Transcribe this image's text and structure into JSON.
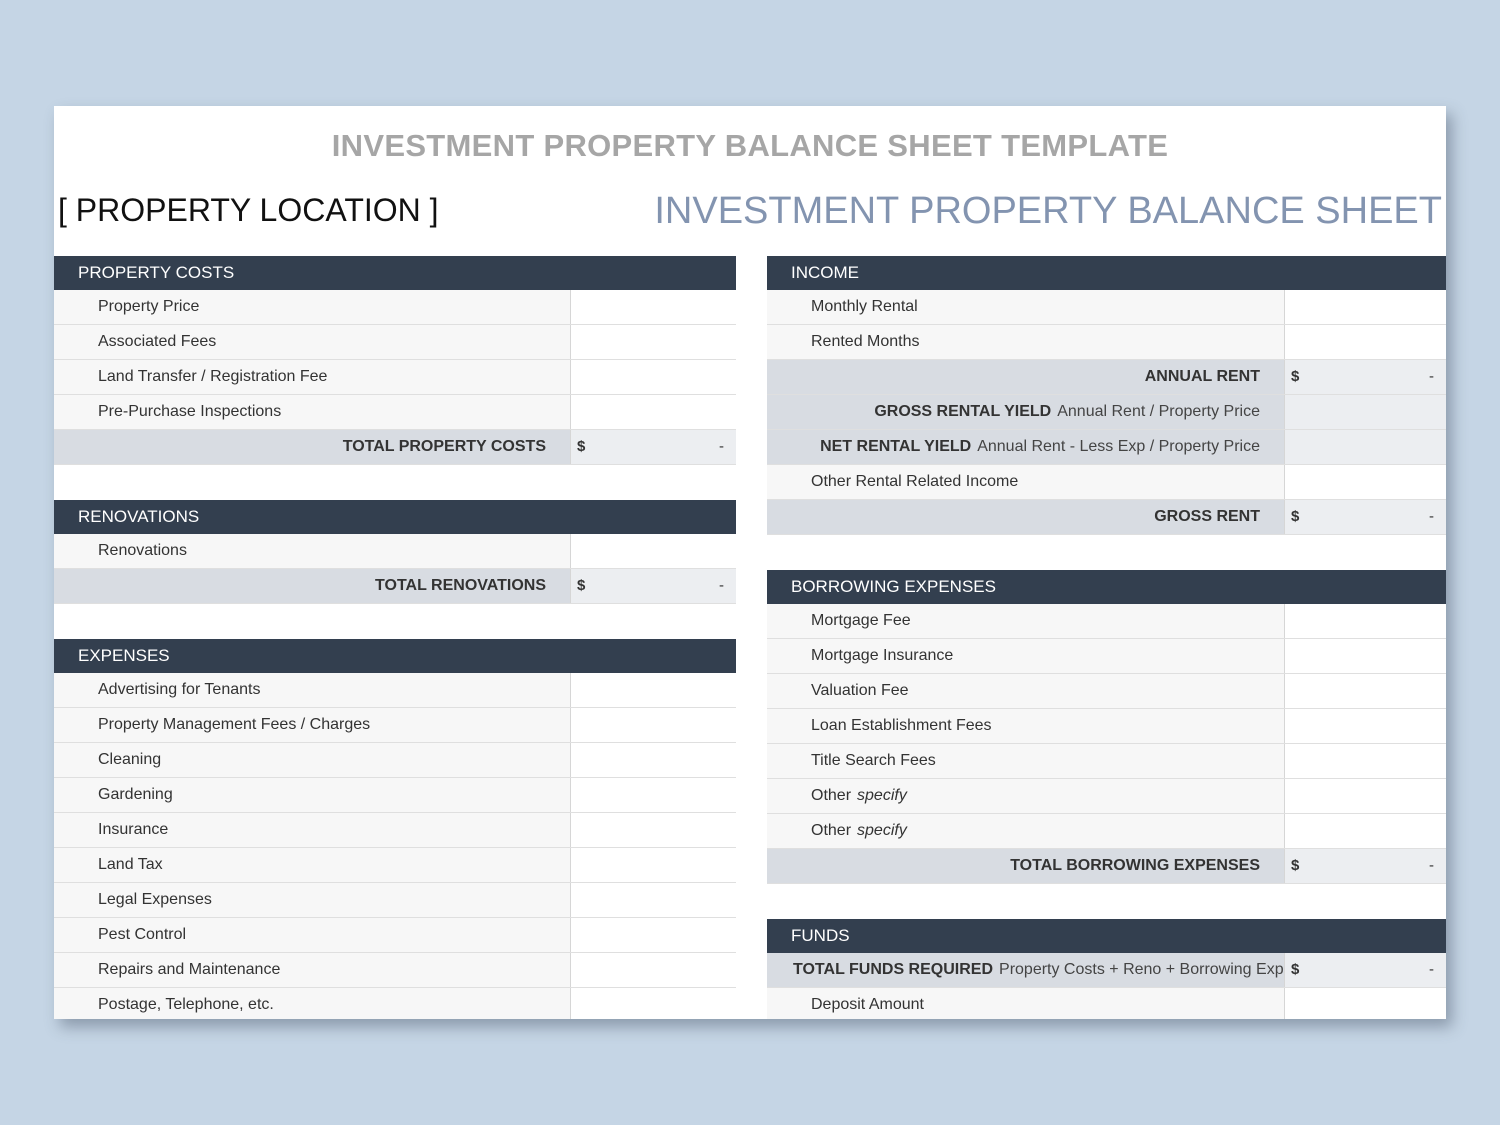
{
  "title": "INVESTMENT PROPERTY BALANCE SHEET TEMPLATE",
  "location": "[ PROPERTY LOCATION ]",
  "subtitle": "INVESTMENT PROPERTY BALANCE SHEET",
  "currency": "$",
  "dash": "-",
  "property_costs": {
    "header": "PROPERTY COSTS",
    "items": [
      "Property Price",
      "Associated Fees",
      "Land Transfer / Registration Fee",
      "Pre-Purchase Inspections"
    ],
    "total_label": "TOTAL PROPERTY COSTS"
  },
  "renovations": {
    "header": "RENOVATIONS",
    "items": [
      "Renovations"
    ],
    "total_label": "TOTAL RENOVATIONS"
  },
  "expenses": {
    "header": "EXPENSES",
    "items": [
      "Advertising for Tenants",
      "Property Management Fees / Charges",
      "Cleaning",
      "Gardening",
      "Insurance",
      "Land Tax",
      "Legal Expenses",
      "Pest Control",
      "Repairs and Maintenance",
      "Postage, Telephone, etc."
    ]
  },
  "income": {
    "header": "INCOME",
    "monthly_rental": "Monthly Rental",
    "rented_months": "Rented Months",
    "annual_rent": "ANNUAL RENT",
    "gross_yield_label": "GROSS RENTAL YIELD",
    "gross_yield_note": "Annual Rent / Property Price",
    "net_yield_label": "NET RENTAL YIELD",
    "net_yield_note": "Annual Rent - Less Exp / Property Price",
    "other_income": "Other Rental Related Income",
    "gross_rent": "GROSS RENT"
  },
  "borrowing": {
    "header": "BORROWING EXPENSES",
    "items": [
      "Mortgage Fee",
      "Mortgage Insurance",
      "Valuation Fee",
      "Loan Establishment Fees",
      "Title Search Fees"
    ],
    "other_label": "Other",
    "specify": "specify",
    "total_label": "TOTAL BORROWING EXPENSES"
  },
  "funds": {
    "header": "FUNDS",
    "total_label": "TOTAL FUNDS REQUIRED",
    "total_note": "Property Costs + Reno + Borrowing Exp",
    "deposit": "Deposit Amount"
  }
}
